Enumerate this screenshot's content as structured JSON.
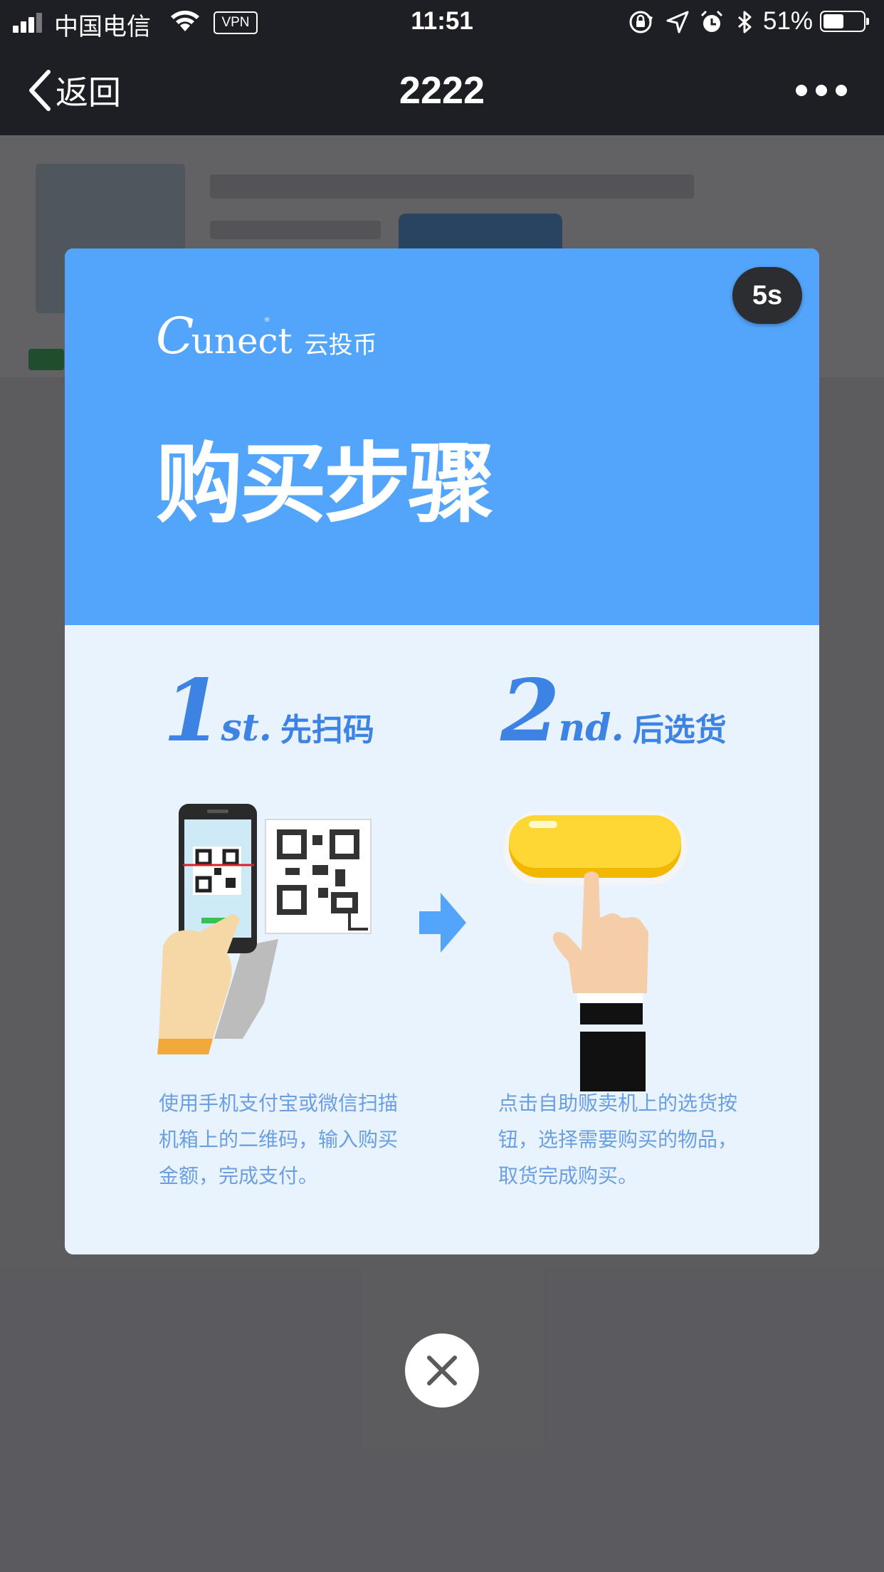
{
  "status_bar": {
    "carrier": "中国电信",
    "vpn": "VPN",
    "time": "11:51",
    "battery": "51%",
    "battery_level": 0.51,
    "icons": [
      "signal-icon",
      "wifi-icon",
      "orientation-lock-icon",
      "location-icon",
      "alarm-icon",
      "bluetooth-icon",
      "battery-icon"
    ]
  },
  "nav": {
    "back_label": "返回",
    "title": "2222",
    "more_icon": "more-icon"
  },
  "modal": {
    "countdown": "5s",
    "brand": {
      "mark": "C",
      "word": "unect",
      "reg": "®",
      "cn": "云投币"
    },
    "title": "购买步骤",
    "steps": [
      {
        "num": "1",
        "suffix": "st.",
        "name": "先扫码",
        "description": "使用手机支付宝或微信扫描机箱上的二维码，输入购买金额，完成支付。",
        "illustration": "scan-qr-illustration"
      },
      {
        "num": "2",
        "suffix": "nd.",
        "name": "后选货",
        "description": "点击自助贩卖机上的选货按钮，选择需要购买的物品，取货完成购买。",
        "illustration": "press-button-illustration"
      }
    ],
    "arrow_icon": "arrow-right-icon"
  },
  "close_button": {
    "icon": "close-icon"
  },
  "colors": {
    "status_nav_bg": "#1e1f24",
    "header_blue": "#53a5fb",
    "panel_light": "#e8f3fe",
    "step_blue": "#3d83e4",
    "desc_blue": "#6b9fe0",
    "dim_bg": "#5f5f63",
    "countdown_bg": "#2b2d31"
  }
}
